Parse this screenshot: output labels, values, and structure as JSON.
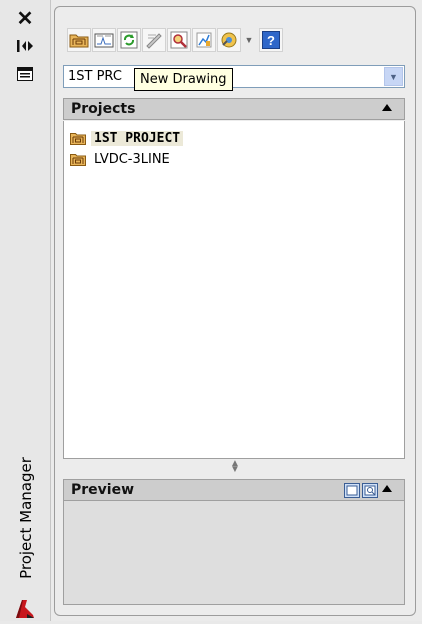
{
  "palette": {
    "title": "Project Manager"
  },
  "strip_icons": [
    "close-icon",
    "auto-hide-icon",
    "properties-icon",
    "autocad-logo-icon"
  ],
  "toolbar": {
    "buttons": [
      "open-project-icon",
      "new-project-icon",
      "refresh-icon",
      "project-properties-icon",
      "search-icon",
      "publish-icon",
      "tools-icon",
      "help-icon"
    ]
  },
  "project_select": {
    "value": "1ST PRC"
  },
  "tooltip": {
    "text": "New Drawing"
  },
  "projects": {
    "header": "Projects",
    "items": [
      {
        "name": "1ST PROJECT",
        "active": true
      },
      {
        "name": "LVDC-3LINE",
        "active": false
      }
    ]
  },
  "preview": {
    "header": "Preview"
  },
  "colors": {
    "panel_bg": "#ececec",
    "header_bg": "#cdcdcd",
    "tooltip_bg": "#ffffe1",
    "combo_border": "#7f9db9"
  }
}
